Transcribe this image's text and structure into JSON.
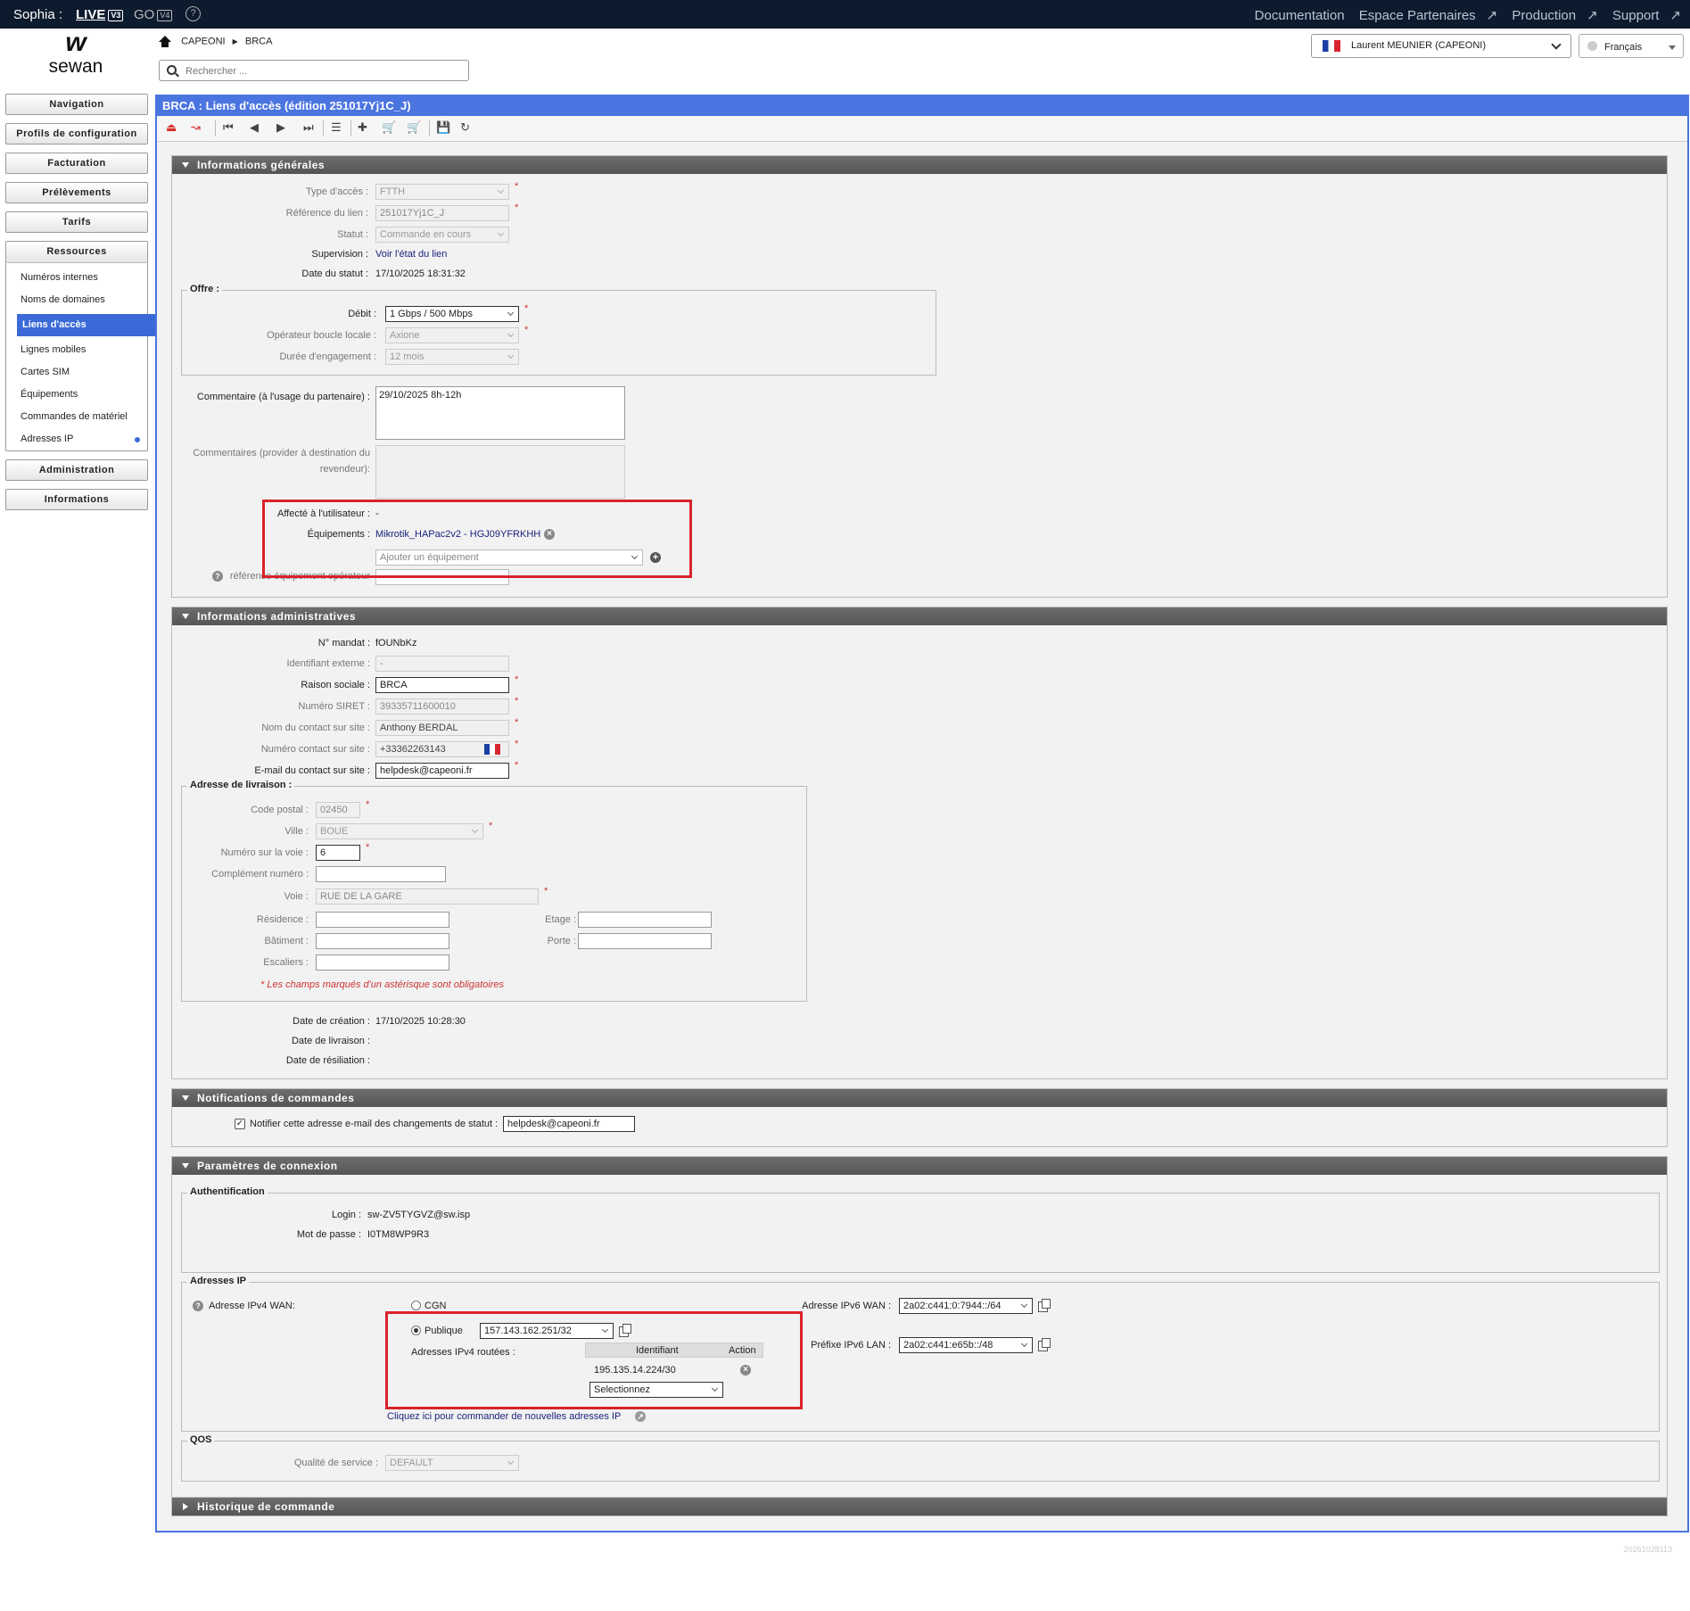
{
  "topbar": {
    "brand": "Sophia :",
    "live": "LIVE",
    "live_tag": "V3",
    "go": "GO",
    "go_tag": "V4",
    "help": "?",
    "links": [
      "Documentation",
      "Espace Partenaires",
      "Production",
      "Support"
    ]
  },
  "logo": {
    "mark": "w",
    "text": "sewan"
  },
  "breadcrumb": {
    "items": [
      "CAPEONI",
      "BRCA"
    ]
  },
  "search": {
    "placeholder": "Rechercher ..."
  },
  "user": {
    "name": "Laurent MEUNIER (CAPEONI)"
  },
  "lang": {
    "value": "Français"
  },
  "sidebar": {
    "buttons": [
      "Navigation",
      "Profils de configuration",
      "Facturation",
      "Prélèvements",
      "Tarifs"
    ],
    "resources_label": "Ressources",
    "resources": [
      "Numéros internes",
      "Noms de domaines",
      "Liens d'accès",
      "Lignes mobiles",
      "Cartes SIM",
      "Équipements",
      "Commandes de matériel",
      "Adresses IP"
    ],
    "bottom": [
      "Administration",
      "Informations"
    ]
  },
  "title": "BRCA : Liens d'accès (édition 251017Yj1C_J)",
  "sections": {
    "general": "Informations générales",
    "admin": "Informations administratives",
    "notif": "Notifications de commandes",
    "conn": "Paramètres de connexion",
    "history": "Historique de commande"
  },
  "general": {
    "type_label": "Type d'accès :",
    "type_value": "FTTH",
    "ref_label": "Référence du lien :",
    "ref_value": "251017Yj1C_J",
    "statut_label": "Statut :",
    "statut_value": "Commande en cours",
    "supervision_label": "Supervision :",
    "supervision_value": "Voir l'état du lien",
    "date_statut_label": "Date du statut :",
    "date_statut_value": "17/10/2025 18:31:32",
    "offre_legend": "Offre :",
    "debit_label": "Débit :",
    "debit_value": "1 Gbps / 500 Mbps",
    "operateur_label": "Opérateur boucle locale :",
    "operateur_value": "Axione",
    "duree_label": "Durée d'engagement :",
    "duree_value": "12 mois",
    "comment_label": "Commentaire (à l'usage du partenaire) :",
    "comment_value": "29/10/2025 8h-12h",
    "comments_provider_label_1": "Commentaires (provider à destination du",
    "comments_provider_label_2": "revendeur):",
    "affecte_label": "Affecté à l'utilisateur :",
    "affecte_value": "-",
    "equip_label": "Équipements :",
    "equip_value": "Mikrotik_HAPac2v2 - HGJ09YFRKHH",
    "add_equip_placeholder": "Ajouter un équipement",
    "ref_equip_label": "référence équipement opérateur"
  },
  "admin": {
    "mandat_label": "N° mandat :",
    "mandat_value": "fOUNbKz",
    "ext_label": "Identifiant externe :",
    "ext_value": "-",
    "raison_label": "Raison sociale :",
    "raison_value": "BRCA",
    "siret_label": "Numéro SIRET :",
    "siret_value": "39335711600010",
    "contact_label": "Nom du contact sur site :",
    "contact_value": "Anthony BERDAL",
    "phone_label": "Numéro contact sur site :",
    "phone_value": "+33362263143",
    "email_label": "E-mail du contact sur site :",
    "email_value": "helpdesk@capeoni.fr",
    "addr_legend": "Adresse de livraison :",
    "cp_label": "Code postal :",
    "cp_value": "02450",
    "ville_label": "Ville :",
    "ville_value": "BOUE",
    "num_label": "Numéro sur la voie :",
    "num_value": "6",
    "compl_label": "Complément numéro :",
    "voie_label": "Voie :",
    "voie_value": "RUE DE LA GARE",
    "residence_label": "Résidence :",
    "etage_label": "Etage :",
    "batiment_label": "Bâtiment :",
    "porte_label": "Porte :",
    "escaliers_label": "Escaliers :",
    "required_note": "* Les champs marqués d'un astérisque sont obligatoires",
    "creation_label": "Date de création :",
    "creation_value": "17/10/2025 10:28:30",
    "livraison_label": "Date de livraison :",
    "resiliation_label": "Date de résiliation :"
  },
  "notif": {
    "label": "Notifier cette adresse e-mail des changements de statut :",
    "value": "helpdesk@capeoni.fr"
  },
  "conn": {
    "auth_legend": "Authentification",
    "login_label": "Login :",
    "login_value": "sw-ZV5TYGVZ@sw.isp",
    "pwd_label": "Mot de passe :",
    "pwd_value": "I0TM8WP9R3",
    "ip_legend": "Adresses IP",
    "ipv4_label": "Adresse IPv4 WAN:",
    "cgn": "CGN",
    "publique": "Publique",
    "ipv4_value": "157.143.162.251/32",
    "routed_label": "Adresses IPv4 routées :",
    "col_id": "Identifiant",
    "col_action": "Action",
    "routed_value": "195.135.14.224/30",
    "select_placeholder": "Selectionnez",
    "order_link": "Cliquez ici pour commander de nouvelles adresses IP",
    "ipv6_wan_label": "Adresse IPv6 WAN :",
    "ipv6_wan_value": "2a02:c441:0:7944::/64",
    "ipv6_lan_label": "Préfixe IPv6 LAN :",
    "ipv6_lan_value": "2a02:c441:e65b::/48",
    "qos_legend": "QOS",
    "qos_label": "Qualité de service :",
    "qos_value": "DEFAULT"
  },
  "footer": {
    "version": "20251028113"
  },
  "colors": {
    "navy": "#0d1b2e",
    "accent": "#4a74e0",
    "highlight": "#d9232a",
    "required": "#cc3333"
  }
}
